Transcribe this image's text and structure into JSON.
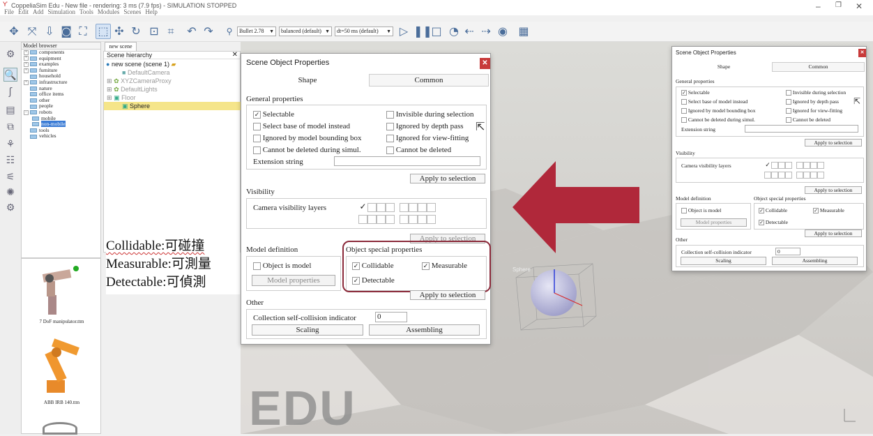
{
  "window": {
    "title": "CoppeliaSim Edu - New file - rendering: 3 ms (7.9 fps) - SIMULATION STOPPED"
  },
  "menu": [
    "File",
    "Edit",
    "Add",
    "Simulation",
    "Tools",
    "Modules",
    "Scenes",
    "Help"
  ],
  "toolbar": {
    "engine": "Bullet 2.78",
    "mode": "balanced (default)",
    "dt": "dt=50 ms (default)"
  },
  "model_browser": {
    "title": "Model browser",
    "items": [
      "components",
      "equipment",
      "examples",
      "furniture",
      "household",
      "infrastructure",
      "nature",
      "office items",
      "other",
      "people",
      "robots",
      "mobile",
      "non-mobile",
      "tools",
      "vehicles"
    ]
  },
  "thumbnails": [
    {
      "label": "7 DoF manipulator.ttm"
    },
    {
      "label": "ABB IRB 140.ttm"
    }
  ],
  "scene_tab": "new scene",
  "hierarchy": {
    "title": "Scene hierarchy",
    "root": "new scene (scene 1)",
    "items": [
      "DefaultCamera",
      "XYZCameraProxy",
      "DefaultLights",
      "Floor",
      "Sphere"
    ]
  },
  "annotation": {
    "line1": "Collidable:可碰撞",
    "line2": "Measurable:可測量",
    "line3": "Detectable:可偵測"
  },
  "dialog": {
    "title": "Scene Object Properties",
    "tab_shape": "Shape",
    "tab_common": "Common",
    "general": "General properties",
    "selectable": "Selectable",
    "invisible": "Invisible during selection",
    "select_base": "Select base of model instead",
    "ignored_depth": "Ignored by depth pass",
    "ignored_bbox": "Ignored by model bounding  box",
    "ignored_view": "Ignored for view-fitting",
    "cannot_sim": "Cannot be deleted during simul.",
    "cannot_del": "Cannot be deleted",
    "ext": "Extension string",
    "apply": "Apply to selection",
    "visibility": "Visibility",
    "cam_layers": "Camera visibility layers",
    "model_def": "Model definition",
    "obj_special": "Object special properties",
    "is_model": "Object is model",
    "model_props": "Model properties",
    "collidable": "Collidable",
    "measurable": "Measurable",
    "detectable": "Detectable",
    "other": "Other",
    "collection": "Collection self-collision indicator",
    "collection_val": "0",
    "scaling": "Scaling",
    "assembling": "Assembling"
  },
  "scene_label": "Sphere",
  "watermark": "EDU",
  "colors": {
    "arrow": "#b0283a",
    "highlight": "#8b2a3a",
    "selection": "#3a7bd5"
  }
}
